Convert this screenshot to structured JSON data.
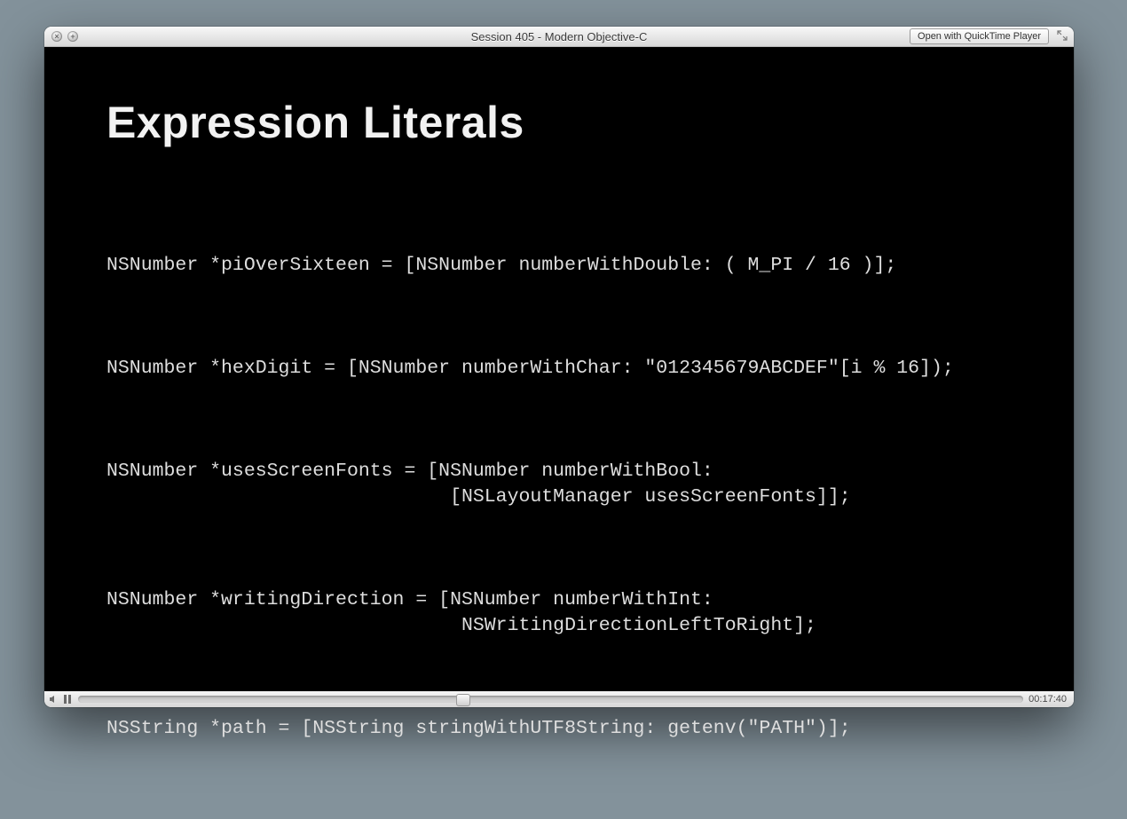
{
  "window": {
    "title": "Session 405 - Modern Objective-C",
    "open_with_label": "Open with QuickTime Player"
  },
  "slide": {
    "heading": "Expression Literals",
    "lines": [
      "NSNumber *piOverSixteen = [NSNumber numberWithDouble: ( M_PI / 16 )];",
      "NSNumber *hexDigit = [NSNumber numberWithChar: \"012345679ABCDEF\"[i % 16]);",
      "NSNumber *usesScreenFonts = [NSNumber numberWithBool:\n                              [NSLayoutManager usesScreenFonts]];",
      "NSNumber *writingDirection = [NSNumber numberWithInt:\n                               NSWritingDirectionLeftToRight];",
      "NSString *path = [NSString stringWithUTF8String: getenv(\"PATH\")];"
    ]
  },
  "player": {
    "timestamp": "00:17:40"
  }
}
